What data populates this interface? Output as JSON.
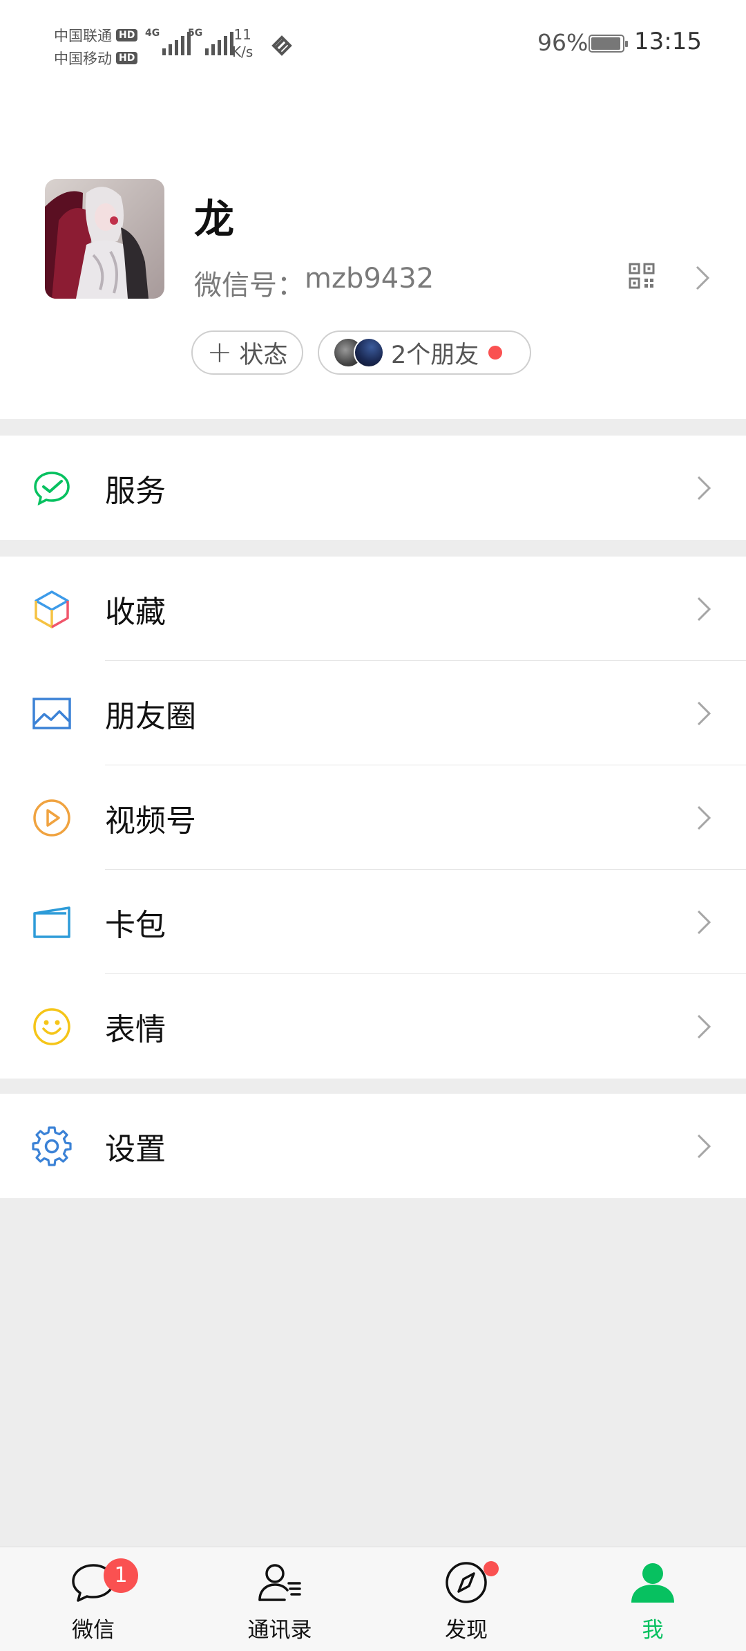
{
  "status_bar": {
    "carrier1": "中国联通",
    "carrier2": "中国移动",
    "hd": "HD",
    "net1": "4G",
    "net2": "5G",
    "speed_value": "11",
    "speed_unit": "K/s",
    "battery_percent": "96%",
    "battery_level": 0.96,
    "time": "13:15"
  },
  "profile": {
    "nickname": "龙",
    "wechat_id_label": "微信号：",
    "wechat_id": "mzb9432",
    "status_button": "状态",
    "friends_text": "2个朋友"
  },
  "menu": {
    "services": "服务",
    "favorites": "收藏",
    "moments": "朋友圈",
    "channels": "视频号",
    "cards": "卡包",
    "stickers": "表情",
    "settings": "设置"
  },
  "tabs": {
    "chats": "微信",
    "chats_badge": "1",
    "contacts": "通讯录",
    "discover": "发现",
    "me": "我"
  },
  "colors": {
    "accent_green": "#07c160",
    "badge_red": "#fa5151",
    "background": "#ededed"
  }
}
